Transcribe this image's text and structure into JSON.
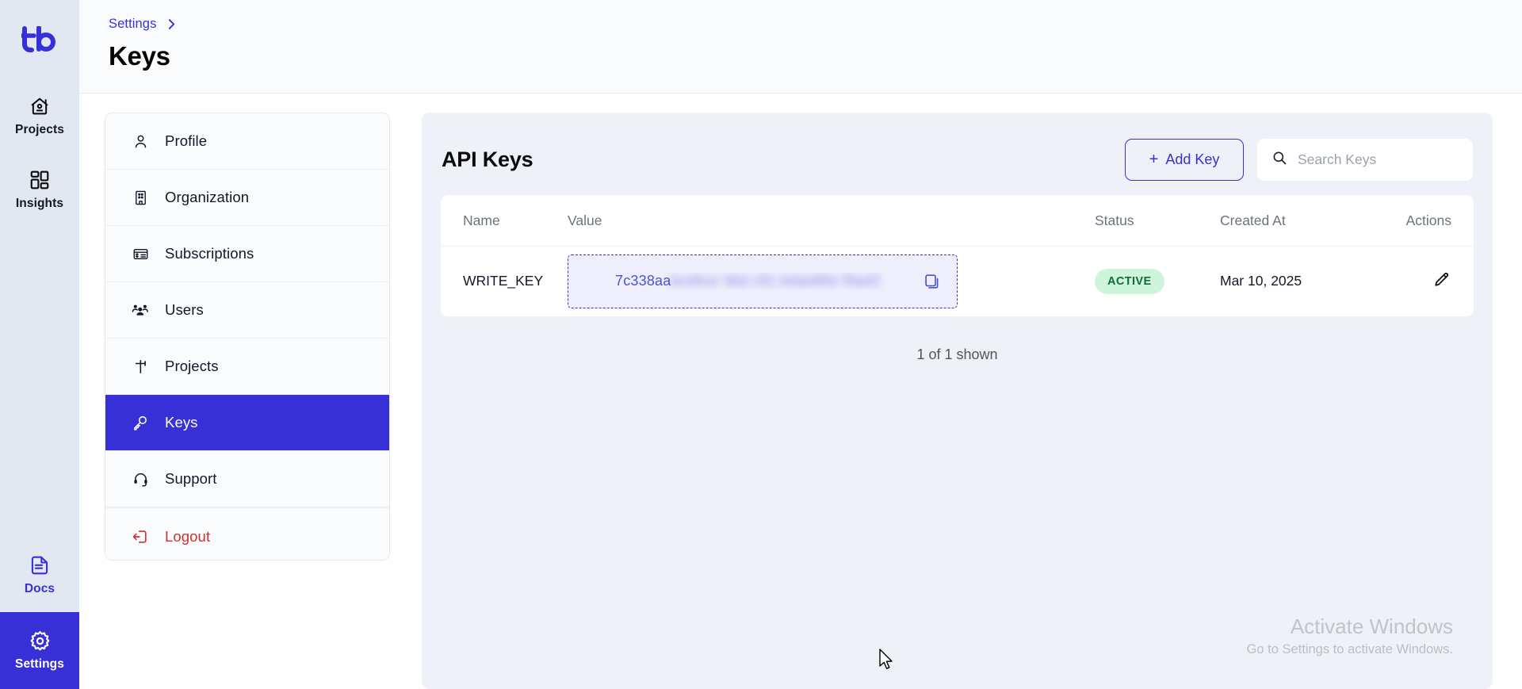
{
  "brand": {
    "logo_text": "tb",
    "accent": "#3730d6"
  },
  "rail": {
    "items": [
      {
        "label": "Projects",
        "icon": "home-user-icon",
        "active": false
      },
      {
        "label": "Insights",
        "icon": "dashboard-grid-icon",
        "active": false
      }
    ],
    "bottom_items": [
      {
        "label": "Docs",
        "icon": "document-icon",
        "active": false
      },
      {
        "label": "Settings",
        "icon": "gear-icon",
        "active": true
      }
    ]
  },
  "header": {
    "breadcrumb": [
      "Settings"
    ],
    "breadcrumb_separator": "›",
    "title": "Keys"
  },
  "settings_menu": {
    "items": [
      {
        "label": "Profile",
        "icon": "user-icon",
        "selected": false
      },
      {
        "label": "Organization",
        "icon": "building-icon",
        "selected": false
      },
      {
        "label": "Subscriptions",
        "icon": "card-list-icon",
        "selected": false
      },
      {
        "label": "Users",
        "icon": "users-icon",
        "selected": false
      },
      {
        "label": "Projects",
        "icon": "sitemap-icon",
        "selected": false
      },
      {
        "label": "Keys",
        "icon": "key-icon",
        "selected": true
      },
      {
        "label": "Support",
        "icon": "headset-icon",
        "selected": false
      }
    ],
    "logout": {
      "label": "Logout",
      "icon": "logout-icon",
      "color": "#d32f2f"
    }
  },
  "panel": {
    "title": "API Keys",
    "add_button": {
      "label": "Add Key",
      "plus": "+"
    },
    "search": {
      "placeholder": "Search Keys",
      "value": "",
      "icon": "search-icon"
    },
    "table": {
      "columns": [
        "Name",
        "Value",
        "Status",
        "Created At",
        "Actions"
      ],
      "rows": [
        {
          "name": "WRITE_KEY",
          "value_visible": "7c338aa",
          "value_masked": "bcd5ce 3bd c91 b4ae80e f0ad3",
          "copy_icon": "copy-icon",
          "status": "ACTIVE",
          "status_bg": "#cdf5dc",
          "status_fg": "#136c36",
          "created_at": "Mar 10, 2025",
          "action_icon": "pencil-icon"
        }
      ]
    },
    "footer_note": "1 of 1 shown"
  },
  "watermark": {
    "line1": "Activate Windows",
    "line2": "Go to Settings to activate Windows."
  }
}
